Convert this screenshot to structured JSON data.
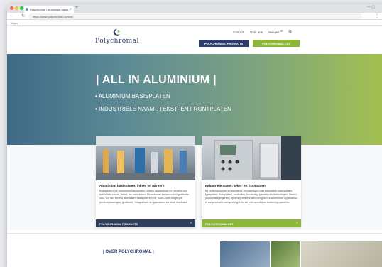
{
  "browser": {
    "tab_title": "Polychromal | aluminium basis...",
    "url": "https://www.polychromal.com/nl/",
    "bookmark": "Apps",
    "new_tab": "+"
  },
  "header": {
    "logo_text": "Polychromal",
    "top_links": [
      "Contact",
      "Over ons",
      "Nieuws"
    ],
    "btn_products": "POLYCHROMAL PRODUCTS",
    "btn_ldt": "POLYCHROMAL LDT"
  },
  "hero": {
    "title": "| ALL IN ALUMINIUM |",
    "bullet1": "• ALUMINIUM BASISPLATEN",
    "bullet2": "• INDUSTRIËLE NAAM-, TEKST- EN FRONTPLATEN"
  },
  "cards": [
    {
      "title": "Aluminium basisplaten, inkten en printers",
      "text": "Basisplaten die aluminium basisplaten, inkten, apparatuur en printers voor industriële naam-, tekst- en frontplaten. Leverancier en aanbod-signalisatie van. Vul hier tevens aluminium basisplaten vind, basis-voor-mogelijke printtoepassingen, grafische, fotografisch en gravadora en deze feedback.",
      "footer": "POLYCHROMAL PRODUCTS"
    },
    {
      "title": "Industriële naam-, tekst- en frontplaten",
      "text": "Bij Ierlandpolymer ambachtelijk vervaardigen van industriële naamplaten, typeplaten, frontplaten, frontfolies, bediening-panelen en behuizingen. Neem jou kontaktgegevens op ons grafische afwerking welke aluminium apparatuur in uw productie van prototype tot en met aluminium bediening-panelen.",
      "footer": "POLYCHROMAL LDT"
    }
  ],
  "about": {
    "title": "| OVER POLYCHROMAL |"
  },
  "colors": {
    "navy": "#2c3d6b",
    "green": "#8cb63c",
    "card_navy": "#2f3c5a"
  }
}
